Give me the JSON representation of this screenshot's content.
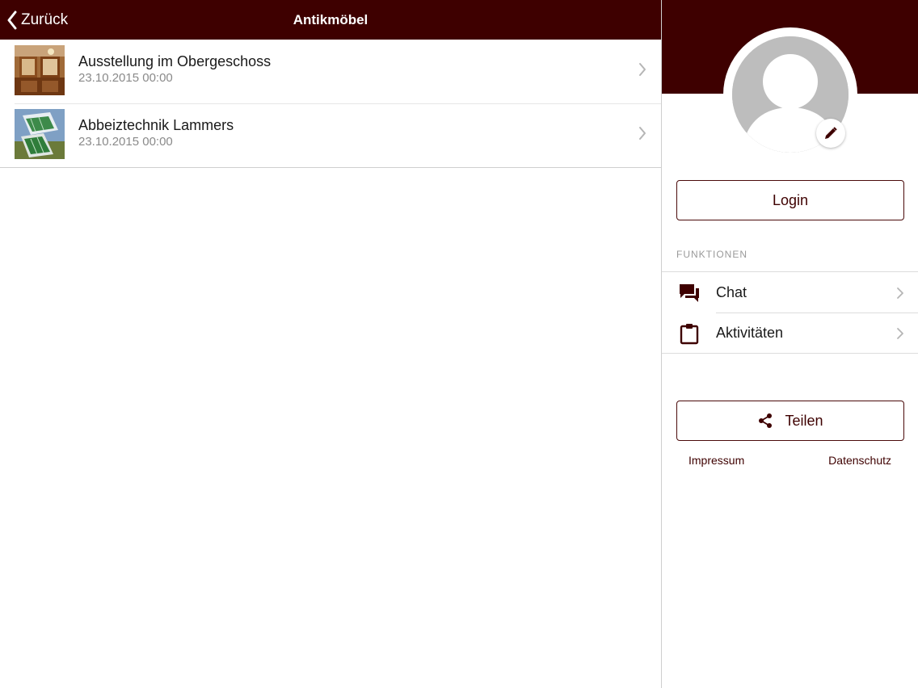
{
  "header": {
    "back_label": "Zurück",
    "title": "Antikmöbel"
  },
  "list": {
    "items": [
      {
        "title": "Ausstellung im Obergeschoss",
        "date": "23.10.2015 00:00",
        "icon": "chevron-right-icon"
      },
      {
        "title": "Abbeiztechnik Lammers",
        "date": "23.10.2015 00:00",
        "icon": "chevron-right-icon"
      }
    ]
  },
  "sidebar": {
    "login_label": "Login",
    "section_label": "FUNKTIONEN",
    "functions": [
      {
        "label": "Chat",
        "icon": "chat-icon"
      },
      {
        "label": "Aktivitäten",
        "icon": "clipboard-icon"
      }
    ],
    "share_label": "Teilen",
    "impressum_label": "Impressum",
    "datenschutz_label": "Datenschutz"
  },
  "colors": {
    "brand": "#3e0000",
    "avatar_gray": "#bdbdbd",
    "chevron": "#b5b5b5"
  }
}
